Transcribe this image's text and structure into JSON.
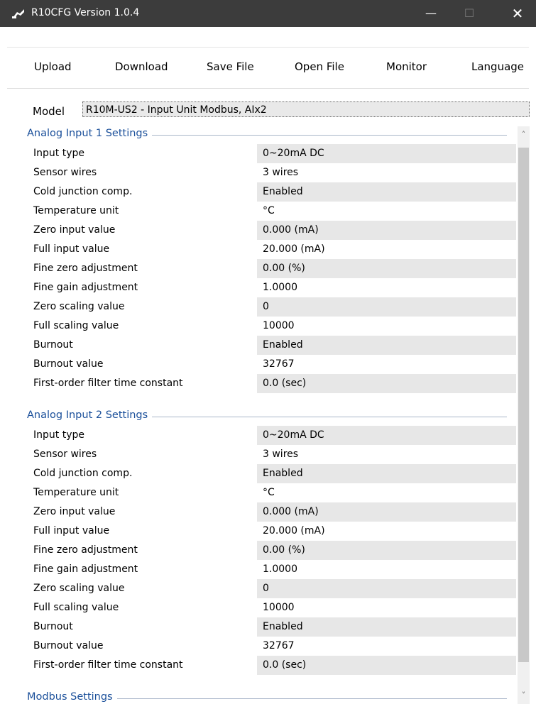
{
  "window": {
    "title": "R10CFG Version 1.0.4",
    "minimize_glyph": "—",
    "maximize_glyph": "☐",
    "close_glyph": "✕"
  },
  "menu": {
    "items": [
      "Upload",
      "Download",
      "Save File",
      "Open File",
      "Monitor",
      "Language"
    ]
  },
  "model": {
    "label": "Model",
    "value": "R10M-US2 - Input Unit Modbus, AIx2"
  },
  "sections": [
    {
      "title": "Analog Input 1 Settings",
      "rows": [
        {
          "label": "Input type",
          "value": "0~20mA DC"
        },
        {
          "label": "Sensor wires",
          "value": "3 wires"
        },
        {
          "label": "Cold junction comp.",
          "value": "Enabled"
        },
        {
          "label": "Temperature unit",
          "value": "°C"
        },
        {
          "label": "Zero input value",
          "value": "0.000 (mA)"
        },
        {
          "label": "Full input value",
          "value": "20.000 (mA)"
        },
        {
          "label": "Fine zero adjustment",
          "value": "0.00 (%)"
        },
        {
          "label": "Fine gain adjustment",
          "value": "1.0000"
        },
        {
          "label": "Zero scaling value",
          "value": "0"
        },
        {
          "label": "Full scaling value",
          "value": "10000"
        },
        {
          "label": "Burnout",
          "value": "Enabled"
        },
        {
          "label": "Burnout value",
          "value": "32767"
        },
        {
          "label": "First-order filter time constant",
          "value": "0.0 (sec)"
        }
      ]
    },
    {
      "title": "Analog Input 2 Settings",
      "rows": [
        {
          "label": "Input type",
          "value": "0~20mA DC"
        },
        {
          "label": "Sensor wires",
          "value": "3 wires"
        },
        {
          "label": "Cold junction comp.",
          "value": "Enabled"
        },
        {
          "label": "Temperature unit",
          "value": "°C"
        },
        {
          "label": "Zero input value",
          "value": "0.000 (mA)"
        },
        {
          "label": "Full input value",
          "value": "20.000 (mA)"
        },
        {
          "label": "Fine zero adjustment",
          "value": "0.00 (%)"
        },
        {
          "label": "Fine gain adjustment",
          "value": "1.0000"
        },
        {
          "label": "Zero scaling value",
          "value": "0"
        },
        {
          "label": "Full scaling value",
          "value": "10000"
        },
        {
          "label": "Burnout",
          "value": "Enabled"
        },
        {
          "label": "Burnout value",
          "value": "32767"
        },
        {
          "label": "First-order filter time constant",
          "value": "0.0 (sec)"
        }
      ]
    },
    {
      "title": "Modbus Settings",
      "rows": []
    }
  ],
  "scrollbar": {
    "up_glyph": "˄",
    "down_glyph": "˅"
  },
  "colors": {
    "titlebar": "#3c3c3c",
    "section_title": "#1a4f9a",
    "value_shade": "#e7e7e7"
  }
}
